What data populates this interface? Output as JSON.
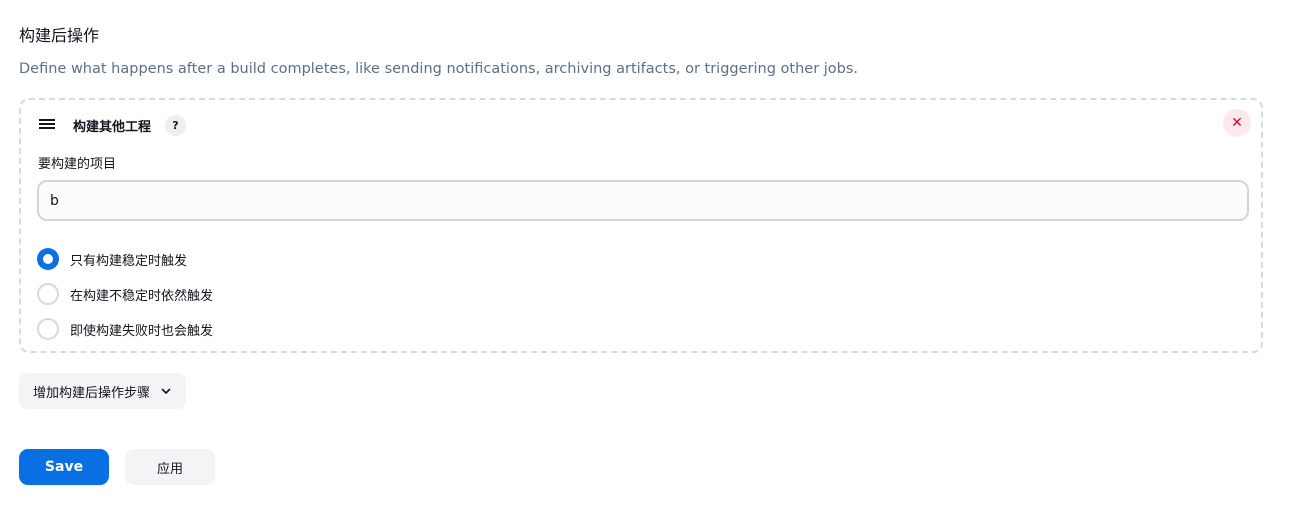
{
  "section": {
    "title": "构建后操作",
    "description": "Define what happens after a build completes, like sending notifications, archiving artifacts, or triggering other jobs."
  },
  "step": {
    "title": "构建其他工程",
    "help_label": "?",
    "delete_label": "✕",
    "field_label": "要构建的项目",
    "projects_value": "b",
    "options": [
      {
        "label": "只有构建稳定时触发",
        "checked": true
      },
      {
        "label": "在构建不稳定时依然触发",
        "checked": false
      },
      {
        "label": "即使构建失败时也会触发",
        "checked": false
      }
    ]
  },
  "add_step_label": "增加构建后操作步骤",
  "buttons": {
    "save_label": "Save",
    "apply_label": "应用"
  },
  "colors": {
    "accent": "#0b6fe4",
    "description_text": "#5c6f8a",
    "delete_bg": "#fde8eb",
    "delete_fg": "#e6001f"
  }
}
